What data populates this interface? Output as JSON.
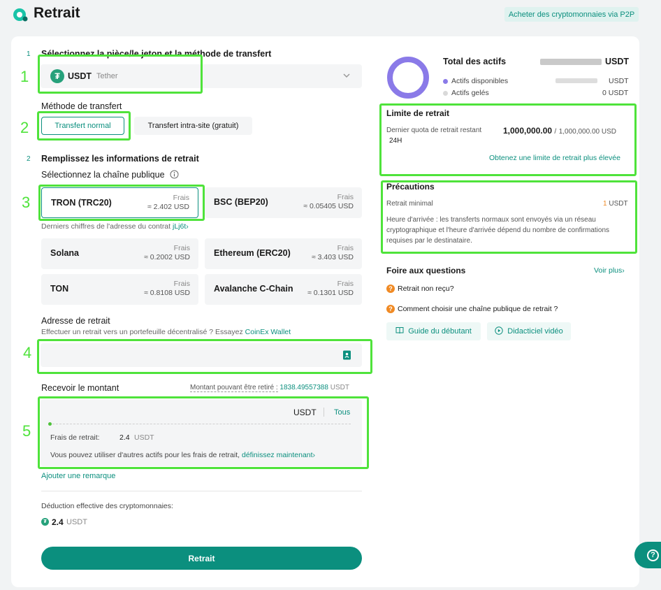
{
  "header": {
    "title": "Retrait",
    "p2p_link": "Acheter des cryptomonnaies via P2P"
  },
  "step1": {
    "number": "1",
    "title": "Sélectionnez la pièce/le jeton et la méthode de transfert",
    "coin": {
      "symbol": "USDT",
      "name": "Tether",
      "icon": "tether-icon"
    },
    "method_label": "Méthode de transfert",
    "methods": [
      {
        "label": "Transfert normal",
        "active": true
      },
      {
        "label": "Transfert intra-site (gratuit)",
        "active": false
      }
    ]
  },
  "step2": {
    "number": "2",
    "title": "Remplissez les informations de retrait",
    "chain_label": "Sélectionnez la chaîne publique",
    "contract_hint": "Derniers chiffres de l'adresse du contrat",
    "contract_suffix": "jLj6t",
    "chains": [
      {
        "name": "TRON (TRC20)",
        "fee_label": "Frais",
        "fee": "≈ 2.402 USD",
        "selected": true
      },
      {
        "name": "BSC (BEP20)",
        "fee_label": "Frais",
        "fee": "≈ 0.05405 USD",
        "selected": false
      },
      {
        "name": "Solana",
        "fee_label": "Frais",
        "fee": "≈ 0.2002 USD",
        "selected": false
      },
      {
        "name": "Ethereum (ERC20)",
        "fee_label": "Frais",
        "fee": "≈ 3.403 USD",
        "selected": false
      },
      {
        "name": "TON",
        "fee_label": "Frais",
        "fee": "≈ 0.8108 USD",
        "selected": false
      },
      {
        "name": "Avalanche C-Chain",
        "fee_label": "Frais",
        "fee": "≈ 0.1301 USD",
        "selected": false
      }
    ]
  },
  "address": {
    "title": "Adresse de retrait",
    "hint": "Effectuer un retrait vers un portefeuille décentralisé ? Essayez",
    "hint_link": "CoinEx Wallet",
    "value": ""
  },
  "amount": {
    "title": "Recevoir le montant",
    "available_label": "Montant pouvant être retiré :",
    "available_value": "1838.49557388",
    "available_unit": "USDT",
    "currency": "USDT",
    "all_label": "Tous",
    "slider_fraction": 0,
    "fee_label": "Frais de retrait:",
    "fee_value": "2.4",
    "fee_unit": "USDT",
    "other_assets_text": "Vous pouvez utiliser d'autres actifs pour les frais de retrait,",
    "other_assets_link": "définissez maintenant"
  },
  "remark_link": "Ajouter une remarque",
  "deduction": {
    "label": "Déduction effective des cryptomonnaies:",
    "value": "2.4",
    "unit": "USDT"
  },
  "submit_label": "Retrait",
  "assets": {
    "title": "Total des actifs",
    "total_unit": "USDT",
    "available_label": "Actifs disponibles",
    "available_unit": "USDT",
    "frozen_label": "Actifs gelés",
    "frozen_value": "0 USDT",
    "available_color": "#8a7ae8",
    "frozen_color": "#d9d9d9"
  },
  "limit": {
    "title": "Limite de retrait",
    "quota_label": "Dernier quota de retrait restant",
    "quota_period": "24H",
    "quota_value": "1,000,000.00",
    "quota_sep": "/",
    "quota_max": "1,000,000.00 USD",
    "raise_link": "Obtenez une limite de retrait plus élevée"
  },
  "precautions": {
    "title": "Précautions",
    "min_label": "Retrait minimal",
    "min_value": "1",
    "min_unit": "USDT",
    "arrival_text": "Heure d'arrivée : les transferts normaux sont envoyés via un réseau cryptographique et l'heure d'arrivée dépend du nombre de confirmations requises par le destinataire."
  },
  "faq": {
    "title": "Foire aux questions",
    "more_link": "Voir plus",
    "items": [
      "Retrait non reçu?",
      "Comment choisir une chaîne publique de retrait ?"
    ],
    "guide_btn": "Guide du débutant",
    "video_btn": "Didacticiel vidéo"
  },
  "annotations": [
    "1",
    "2",
    "3",
    "4",
    "5"
  ],
  "colors": {
    "accent": "#0b8f7e",
    "highlight": "#4fe33b",
    "warning": "#f08a24"
  }
}
